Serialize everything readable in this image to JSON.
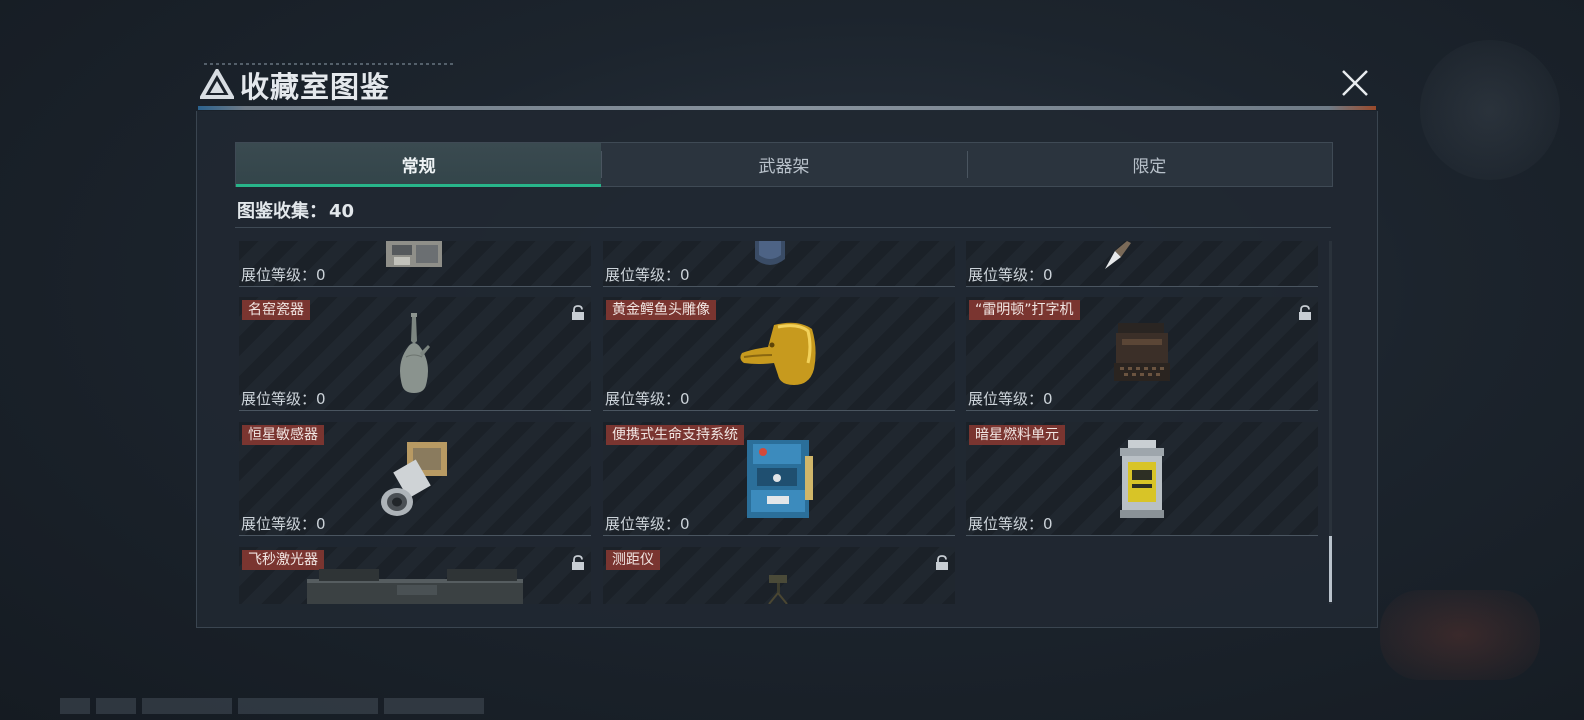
{
  "header": {
    "title": "收藏室图鉴",
    "logo_icon": "triangle-logo-icon",
    "close_icon": "close-x-icon"
  },
  "tabs": [
    {
      "label": "常规",
      "active": true
    },
    {
      "label": "武器架",
      "active": false
    },
    {
      "label": "限定",
      "active": false
    }
  ],
  "collection": {
    "label": "图鉴收集：",
    "count": "40"
  },
  "items": [
    {
      "name": "",
      "level_label": "展位等级：",
      "level": "0",
      "locked": false,
      "icon": "machine-partial-icon"
    },
    {
      "name": "",
      "level_label": "展位等级：",
      "level": "0",
      "locked": false,
      "icon": "canister-partial-icon"
    },
    {
      "name": "",
      "level_label": "展位等级：",
      "level": "0",
      "locked": false,
      "icon": "arrowhead-icon"
    },
    {
      "name": "名窑瓷器",
      "level_label": "展位等级：",
      "level": "0",
      "locked": true,
      "icon": "porcelain-vase-icon"
    },
    {
      "name": "黄金鳄鱼头雕像",
      "level_label": "展位等级：",
      "level": "0",
      "locked": false,
      "icon": "golden-crocodile-head-icon"
    },
    {
      "name": "“雷明顿”打字机",
      "level_label": "展位等级：",
      "level": "0",
      "locked": true,
      "icon": "typewriter-icon"
    },
    {
      "name": "恒星敏感器",
      "level_label": "展位等级：",
      "level": "0",
      "locked": false,
      "icon": "star-sensor-icon"
    },
    {
      "name": "便携式生命支持系统",
      "level_label": "展位等级：",
      "level": "0",
      "locked": false,
      "icon": "life-support-system-icon"
    },
    {
      "name": "暗星燃料单元",
      "level_label": "展位等级：",
      "level": "0",
      "locked": false,
      "icon": "fuel-cell-icon"
    },
    {
      "name": "飞秒激光器",
      "level_label": "",
      "level": "",
      "locked": true,
      "icon": "laser-box-icon"
    },
    {
      "name": "测距仪",
      "level_label": "",
      "level": "",
      "locked": true,
      "icon": "rangefinder-tripod-icon"
    }
  ],
  "colors": {
    "accent": "#28b58a",
    "tag_bg": "#7a3530",
    "panel_bg": "#202831"
  }
}
